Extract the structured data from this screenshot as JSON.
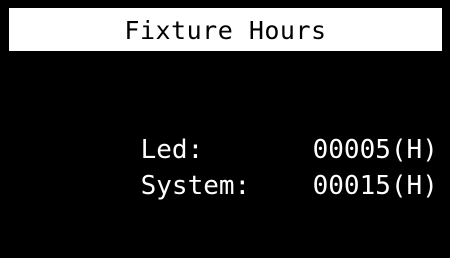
{
  "title": "Fixture Hours",
  "rows": [
    {
      "label": "Led:",
      "value": "00005(H)"
    },
    {
      "label": "System:",
      "value": "00015(H)"
    }
  ],
  "colors": {
    "background": "#000000",
    "title_background": "#ffffff",
    "text": "#ffffff",
    "title_text": "#000000"
  }
}
